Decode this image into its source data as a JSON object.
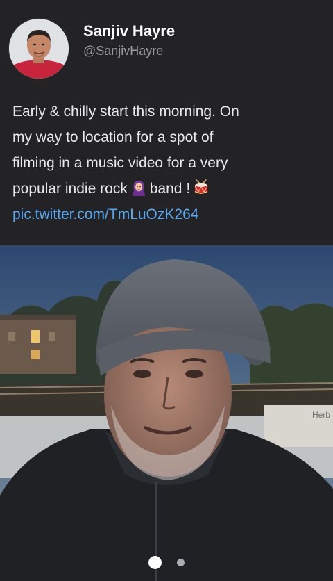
{
  "colors": {
    "background": "#232325",
    "name_text": "#ffffff",
    "handle_text": "#9a9ba0",
    "body_text": "#e9e9ec",
    "link": "#5aa8f0"
  },
  "author": {
    "name": "Sanjiv Hayre",
    "handle": "@SanjivHayre",
    "avatar_icon": "profile-photo"
  },
  "tweet": {
    "line1": "Early & chilly start this morning. On",
    "line2": "my way to location for a spot of",
    "line3": "filming in a music video for a very",
    "line4_start": "popular indie rock",
    "emoji1": "person-with-headscarf-emoji",
    "line4_mid": "band !",
    "emoji2": "drum-emoji",
    "link": "pic.twitter.com/TmLuOzK264"
  },
  "media": {
    "description_icon": "selfie-photo",
    "background_sign": "Herb",
    "carousel": {
      "current": 1,
      "total": 2
    }
  }
}
